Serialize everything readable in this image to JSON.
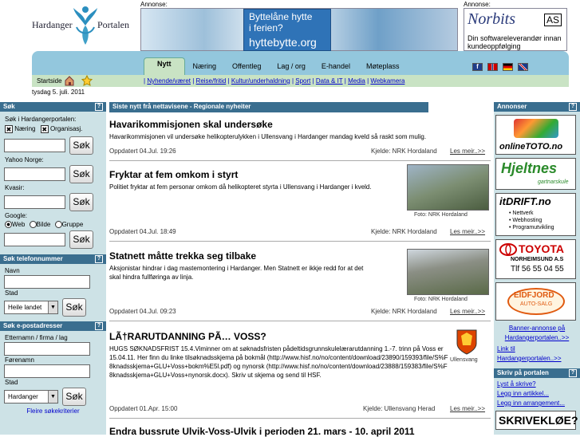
{
  "logo": {
    "left": "Hardanger",
    "right": "Portalen"
  },
  "ads": {
    "label": "Annonse:",
    "hyttebytte_line1": "Byttelåne hytte",
    "hyttebytte_line2": "i ferien?",
    "hyttebytte_url": "hyttebytte.org",
    "norbits_name": "Norbits",
    "norbits_as": "AS",
    "norbits_tag": "Din softwareleverandør innan kundeoppfølging"
  },
  "nav": {
    "tabs": [
      "Nytt",
      "Næring",
      "Offentleg",
      "Lag / org",
      "E-handel",
      "Møteplass"
    ],
    "startside": "Startside",
    "sublinks": [
      "Nyhende/været",
      "Reise/fritid",
      "Kultur/underhaldning",
      "Sport",
      "Data & IT",
      "Media",
      "Webkamera"
    ]
  },
  "date": "tysdag 5. juli. 2011",
  "left": {
    "search": {
      "title": "Søk",
      "portal_label": "Søk i Hardangerportalen:",
      "check1": "Næring",
      "check2": "Organisasj.",
      "btn": "Søk",
      "yahoo": "Yahoo Norge:",
      "kvasir": "Kvasir:",
      "google": "Google:",
      "radio_web": "Web",
      "radio_bilde": "Bilde",
      "radio_gruppe": "Gruppe"
    },
    "phone": {
      "title": "Søk telefonnummer",
      "navn": "Navn",
      "stad": "Stad",
      "select": "Heile landet",
      "btn": "Søk"
    },
    "email": {
      "title": "Søk e-postadresser",
      "etternamn": "Etternamn / firma / lag",
      "fornamn": "Førenamn",
      "stad": "Stad",
      "select": "Hardanger",
      "btn": "Søk",
      "more": "Fleire søkekriterier"
    }
  },
  "main": {
    "heading": "Siste nytt frå nettavisene - Regionale nyheiter",
    "articles": [
      {
        "title": "Havarikommisjonen skal undersøke",
        "desc": "Havarikommisjonen vil undersøke helikopterulykken i Ullensvang i Hardanger mandag kveld så raskt som mulig.",
        "updated": "Oppdatert 04.Jul. 19:26",
        "source": "Kjelde: NRK Hordaland",
        "more": "Les meir..>>"
      },
      {
        "title": "Fryktar at fem omkom i styrt",
        "desc": "Politiet fryktar at fem personar omkom då helikopteret styrta i Ullensvang i Hardanger i kveld.",
        "updated": "Oppdatert 04.Jul. 18:49",
        "source": "Kjelde: NRK Hordaland",
        "more": "Les meir..>>",
        "caption": "Foto: NRK Hordaland"
      },
      {
        "title": "Statnett måtte trekka seg tilbake",
        "desc": "Aksjonistar hindrar i dag mastemontering i Hardanger. Men Statnett er ikkje redd for at det skal hindra fullføringa av linja.",
        "updated": "Oppdatert 04.Jul. 09:23",
        "source": "Kjelde: NRK Hordaland",
        "more": "Les meir..>>",
        "caption": "Foto: NRK Hordaland"
      },
      {
        "title": "LÃ†RARUTDANNING PÃ… VOSS?",
        "desc": "HUGS SØKNADSFRIST 15.4.Viminner om at søknadsfristen pådeltidsgrunnskulelærarutdanning 1.-7. trinn på Voss er 15.04.11. Her finn du linke tilsøknadsskjema på bokmål (http://www.hisf.no/no/content/download/23890/159393/file/S%F8knadsskjema+GLU+Voss+bokm%E5l.pdf) og nynorsk (http://www.hisf.no/no/content/download/23888/159383/file/S%F8knadsskjema+GLU+Voss+nynorsk.docx). Skriv ut skjema og send til HSF.",
        "updated": "Oppdatert 01.Apr. 15:00",
        "source": "Kjelde: Ullensvang Herad",
        "more": "Les meir..>>",
        "caption": "Ullensvang"
      },
      {
        "title": "Endra bussrute Ulvik-Voss-Ulvik i perioden 21. mars - 10. april 2011"
      }
    ]
  },
  "right": {
    "ads_title": "Annonser",
    "onlinetoto": "onlineTOTO.no",
    "hjeltnes": "Hjeltnes",
    "hjeltnes_sub": "gartnarskule",
    "itdrift": "itDRIFT.no",
    "itdrift_items": [
      "Nettverk",
      "Webhosting",
      "Programutvikling"
    ],
    "toyota": "TOYOTA",
    "toyota_sub": "NORHEIMSUND A.S",
    "toyota_tel": "Tlf 56 55 04 55",
    "eidfjord": "EIDFJORD",
    "eidfjord_sub": "AUTO-SALG",
    "banner_link": "Banner-annonse på Hardangerportalen..>>",
    "link_link": "Link til Hardangerportalen..>>",
    "write_title": "Skriv på portalen",
    "write_links": [
      "Lyst å skrive?",
      "Legg inn artikkel...",
      "Legg inn arrangement..."
    ],
    "skriveklo": "SKRIVEKLØE?"
  }
}
